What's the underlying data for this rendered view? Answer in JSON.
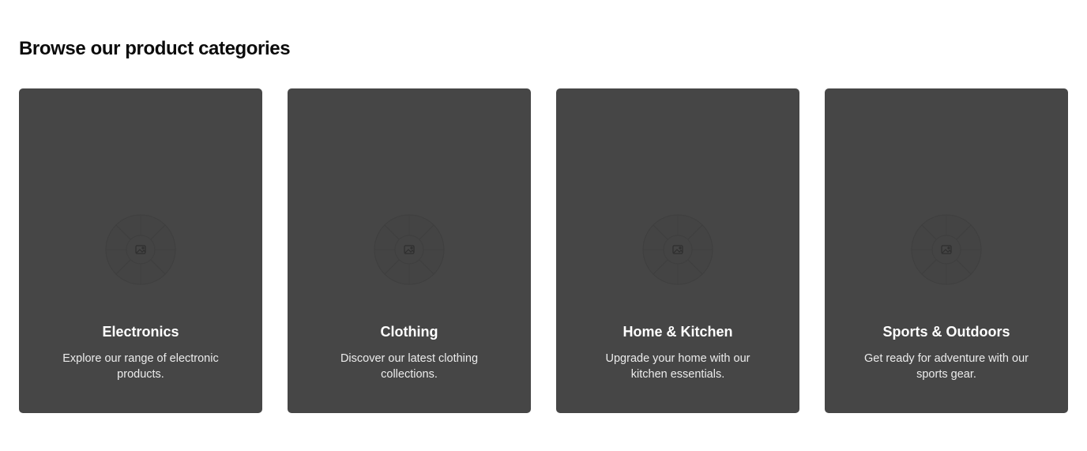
{
  "section": {
    "title": "Browse our product categories"
  },
  "categories": [
    {
      "title": "Electronics",
      "description": "Explore our range of electronic products.",
      "icon": "image-placeholder-icon"
    },
    {
      "title": "Clothing",
      "description": "Discover our latest clothing collections.",
      "icon": "image-placeholder-icon"
    },
    {
      "title": "Home & Kitchen",
      "description": "Upgrade your home with our kitchen essentials.",
      "icon": "image-placeholder-icon"
    },
    {
      "title": "Sports & Outdoors",
      "description": "Get ready for adventure with our sports gear.",
      "icon": "image-placeholder-icon"
    }
  ],
  "colors": {
    "card_background": "#464646",
    "title_text": "#0b0b0b",
    "card_text": "#ffffff"
  }
}
